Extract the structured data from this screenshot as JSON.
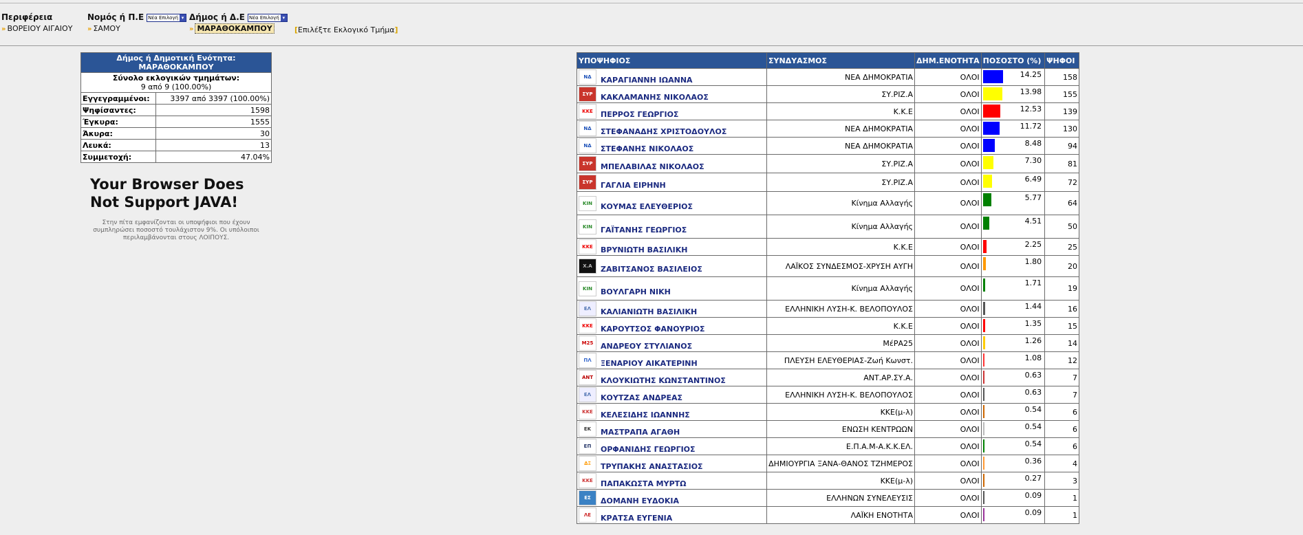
{
  "selectors": {
    "region": {
      "title": "Περιφέρεια",
      "value": "ΒΟΡΕΙΟΥ ΑΙΓΑΙΟΥ"
    },
    "prefecture": {
      "title": "Νομός ή Π.Ε",
      "dropdown": "Νέα Επιλογή",
      "value": "ΣΑΜΟΥ"
    },
    "municipality": {
      "title": "Δήμος ή Δ.Ε",
      "dropdown": "Νέα Επιλογή",
      "value": "ΜΑΡΑΘΟΚΑΜΠΟΥ"
    },
    "section_link": "Επιλέξτε Εκλογικό Τμήμα"
  },
  "summary": {
    "header": "Δήμος ή Δημοτική Ενότητα: ΜΑΡΑΘΟΚΑΜΠΟΥ",
    "total_label": "Σύνολο εκλογικών τμημάτων:",
    "total_value": "9 από 9 (100.00%)",
    "rows": [
      {
        "label": "Εγγεγραμμένοι:",
        "value": "3397 από 3397 (100.00%)"
      },
      {
        "label": "Ψηφίσαντες:",
        "value": "1598"
      },
      {
        "label": "Έγκυρα:",
        "value": "1555"
      },
      {
        "label": "Άκυρα:",
        "value": "30"
      },
      {
        "label": "Λευκά:",
        "value": "13"
      },
      {
        "label": "Συμμετοχή:",
        "value": "47.04%"
      }
    ]
  },
  "java_notice": {
    "title_line1": "Your Browser Does",
    "title_line2": "Not Support JAVA!",
    "note": "Στην πίτα εμφανίζονται οι υποψήφιοι που έχουν συμπληρώσει ποσοστό τουλάχιστον 9%. Οι υπόλοιποι περιλαμβάνονται στους ΛΟΙΠΟΥΣ."
  },
  "results": {
    "headers": [
      "ΥΠΟΨΗΦΙΟΣ",
      "ΣΥΝΔΥΑΣΜΟΣ",
      "ΔΗΜ.ΕΝΟΤΗΤΑ",
      "ΠΟΣΟΣΤΟ (%)",
      "ΨΗΦΟΙ"
    ],
    "rows": [
      {
        "name": "ΚΑΡΑΓΙΑΝΝΗ ΙΩΑΝΝΑ",
        "party": "ΝΕΑ ΔΗΜΟΚΡΑΤΙΑ",
        "unit": "ΟΛΟΙ",
        "pct": 14.25,
        "pct_text": "14.25",
        "votes": "158",
        "color": "#0000ff",
        "logo": "nd-logo-icon"
      },
      {
        "name": "ΚΑΚΛΑΜΑΝΗΣ ΝΙΚΟΛΑΟΣ",
        "party": "ΣΥ.ΡΙΖ.Α",
        "unit": "ΟΛΟΙ",
        "pct": 13.98,
        "pct_text": "13.98",
        "votes": "155",
        "color": "#ffff00",
        "logo": "syriza-logo-icon"
      },
      {
        "name": "ΠΕΡΡΟΣ ΓΕΩΡΓΙΟΣ",
        "party": "Κ.Κ.Ε",
        "unit": "ΟΛΟΙ",
        "pct": 12.53,
        "pct_text": "12.53",
        "votes": "139",
        "color": "#ff0000",
        "logo": "kke-logo-icon"
      },
      {
        "name": "ΣΤΕΦΑΝΑΔΗΣ ΧΡΙΣΤΟΔΟΥΛΟΣ",
        "party": "ΝΕΑ ΔΗΜΟΚΡΑΤΙΑ",
        "unit": "ΟΛΟΙ",
        "pct": 11.72,
        "pct_text": "11.72",
        "votes": "130",
        "color": "#0000ff",
        "logo": "nd-logo-icon"
      },
      {
        "name": "ΣΤΕΦΑΝΗΣ ΝΙΚΟΛΑΟΣ",
        "party": "ΝΕΑ ΔΗΜΟΚΡΑΤΙΑ",
        "unit": "ΟΛΟΙ",
        "pct": 8.48,
        "pct_text": "8.48",
        "votes": "94",
        "color": "#0000ff",
        "logo": "nd-logo-icon"
      },
      {
        "name": "ΜΠΕΛΑΒΙΛΑΣ ΝΙΚΟΛΑΟΣ",
        "party": "ΣΥ.ΡΙΖ.Α",
        "unit": "ΟΛΟΙ",
        "pct": 7.3,
        "pct_text": "7.30",
        "votes": "81",
        "color": "#ffff00",
        "logo": "syriza-logo-icon"
      },
      {
        "name": "ΓΑΓΛΙΑ ΕΙΡΗΝΗ",
        "party": "ΣΥ.ΡΙΖ.Α",
        "unit": "ΟΛΟΙ",
        "pct": 6.49,
        "pct_text": "6.49",
        "votes": "72",
        "color": "#ffff00",
        "logo": "syriza-logo-icon"
      },
      {
        "name": "ΚΟΥΜΑΣ ΕΛΕΥΘΕΡΙΟΣ",
        "party": "Κίνημα Αλλαγής",
        "unit": "ΟΛΟΙ",
        "pct": 5.77,
        "pct_text": "5.77",
        "votes": "64",
        "color": "#008000",
        "logo": "kinal-logo-icon"
      },
      {
        "name": "ΓΑΪΤΑΝΗΣ ΓΕΩΡΓΙΟΣ",
        "party": "Κίνημα Αλλαγής",
        "unit": "ΟΛΟΙ",
        "pct": 4.51,
        "pct_text": "4.51",
        "votes": "50",
        "color": "#008000",
        "logo": "kinal-logo-icon"
      },
      {
        "name": "ΒΡΥΝΙΩΤΗ ΒΑΣΙΛΙΚΗ",
        "party": "Κ.Κ.Ε",
        "unit": "ΟΛΟΙ",
        "pct": 2.25,
        "pct_text": "2.25",
        "votes": "25",
        "color": "#ff0000",
        "logo": "kke-logo-icon"
      },
      {
        "name": "ΖΑΒΙΤΣΑΝΟΣ ΒΑΣΙΛΕΙΟΣ",
        "party": "ΛΑΪΚΟΣ ΣΥΝΔΕΣΜΟΣ-ΧΡΥΣΗ ΑΥΓΗ",
        "unit": "ΟΛΟΙ",
        "pct": 1.8,
        "pct_text": "1.80",
        "votes": "20",
        "color": "#ff9900",
        "logo": "xa-logo-icon"
      },
      {
        "name": "ΒΟΥΛΓΑΡΗ ΝΙΚΗ",
        "party": "Κίνημα Αλλαγής",
        "unit": "ΟΛΟΙ",
        "pct": 1.71,
        "pct_text": "1.71",
        "votes": "19",
        "color": "#008000",
        "logo": "kinal-logo-icon"
      },
      {
        "name": "ΚΑΛΙΑΝΙΩΤΗ ΒΑΣΙΛΙΚΗ",
        "party": "ΕΛΛΗΝΙΚΗ ΛΥΣΗ-Κ. ΒΕΛΟΠΟΥΛΟΣ",
        "unit": "ΟΛΟΙ",
        "pct": 1.44,
        "pct_text": "1.44",
        "votes": "16",
        "color": "#555555",
        "logo": "el-logo-icon"
      },
      {
        "name": "ΚΑΡΟΥΤΣΟΣ ΦΑΝΟΥΡΙΟΣ",
        "party": "Κ.Κ.Ε",
        "unit": "ΟΛΟΙ",
        "pct": 1.35,
        "pct_text": "1.35",
        "votes": "15",
        "color": "#ff0000",
        "logo": "kke-logo-icon"
      },
      {
        "name": "ΑΝΔΡΕΟΥ ΣΤΥΛΙΑΝΟΣ",
        "party": "ΜέΡΑ25",
        "unit": "ΟΛΟΙ",
        "pct": 1.26,
        "pct_text": "1.26",
        "votes": "14",
        "color": "#ffcc00",
        "logo": "mera25-logo-icon"
      },
      {
        "name": "ΞΕΝΑΡΙΟΥ ΑΙΚΑΤΕΡΙΝΗ",
        "party": "ΠΛΕΥΣΗ ΕΛΕΥΘΕΡΙΑΣ-Ζωή Κωνστ.",
        "unit": "ΟΛΟΙ",
        "pct": 1.08,
        "pct_text": "1.08",
        "votes": "12",
        "color": "#ff3333",
        "logo": "pleusi-logo-icon"
      },
      {
        "name": "ΚΛΟΥΚΙΩΤΗΣ ΚΩΝΣΤΑΝΤΙΝΟΣ",
        "party": "ΑΝΤ.ΑΡ.ΣΥ.Α.",
        "unit": "ΟΛΟΙ",
        "pct": 0.63,
        "pct_text": "0.63",
        "votes": "7",
        "color": "#cc3333",
        "logo": "antarsya-logo-icon"
      },
      {
        "name": "ΚΟΥΤΖΑΣ ΑΝΔΡΕΑΣ",
        "party": "ΕΛΛΗΝΙΚΗ ΛΥΣΗ-Κ. ΒΕΛΟΠΟΥΛΟΣ",
        "unit": "ΟΛΟΙ",
        "pct": 0.63,
        "pct_text": "0.63",
        "votes": "7",
        "color": "#555555",
        "logo": "el-logo-icon"
      },
      {
        "name": "ΚΕΛΕΣΙΔΗΣ ΙΩΑΝΝΗΣ",
        "party": "ΚΚΕ(μ-λ)",
        "unit": "ΟΛΟΙ",
        "pct": 0.54,
        "pct_text": "0.54",
        "votes": "6",
        "color": "#cc6600",
        "logo": "kkeml-logo-icon"
      },
      {
        "name": "ΜΑΣΤΡΑΠΑ ΑΓΑΘΗ",
        "party": "ΕΝΩΣΗ ΚΕΝΤΡΩΩΝ",
        "unit": "ΟΛΟΙ",
        "pct": 0.54,
        "pct_text": "0.54",
        "votes": "6",
        "color": "#bbbbbb",
        "logo": "ek-logo-icon"
      },
      {
        "name": "ΟΡΦΑΝΙΔΗΣ ΓΕΩΡΓΙΟΣ",
        "party": "Ε.Π.Α.Μ-Α.Κ.Κ.ΕΛ.",
        "unit": "ΟΛΟΙ",
        "pct": 0.54,
        "pct_text": "0.54",
        "votes": "6",
        "color": "#008000",
        "logo": "epam-logo-icon"
      },
      {
        "name": "ΤΡΥΠΑΚΗΣ ΑΝΑΣΤΑΣΙΟΣ",
        "party": "ΔΗΜΙΟΥΡΓΙΑ ΞΑΝΑ-ΘΑΝΟΣ ΤΖΗΜΕΡΟΣ",
        "unit": "ΟΛΟΙ",
        "pct": 0.36,
        "pct_text": "0.36",
        "votes": "4",
        "color": "#ff9933",
        "logo": "dimiourgia-logo-icon"
      },
      {
        "name": "ΠΑΠΑΚΩΣΤΑ ΜΥΡΤΩ",
        "party": "ΚΚΕ(μ-λ)",
        "unit": "ΟΛΟΙ",
        "pct": 0.27,
        "pct_text": "0.27",
        "votes": "3",
        "color": "#cc6600",
        "logo": "kkeml-logo-icon"
      },
      {
        "name": "ΔΟΜΑΝΗ ΕΥΔΟΚΙΑ",
        "party": "ΕΛΛΗΝΩΝ ΣΥΝΕΛΕΥΣΙΣ",
        "unit": "ΟΛΟΙ",
        "pct": 0.09,
        "pct_text": "0.09",
        "votes": "1",
        "color": "#555555",
        "logo": "es-logo-icon"
      },
      {
        "name": "ΚΡΑΤΣΑ ΕΥΓΕΝΙΑ",
        "party": "ΛΑΪΚΗ ΕΝΟΤΗΤΑ",
        "unit": "ΟΛΟΙ",
        "pct": 0.09,
        "pct_text": "0.09",
        "votes": "1",
        "color": "#993399",
        "logo": "le-logo-icon"
      }
    ]
  }
}
